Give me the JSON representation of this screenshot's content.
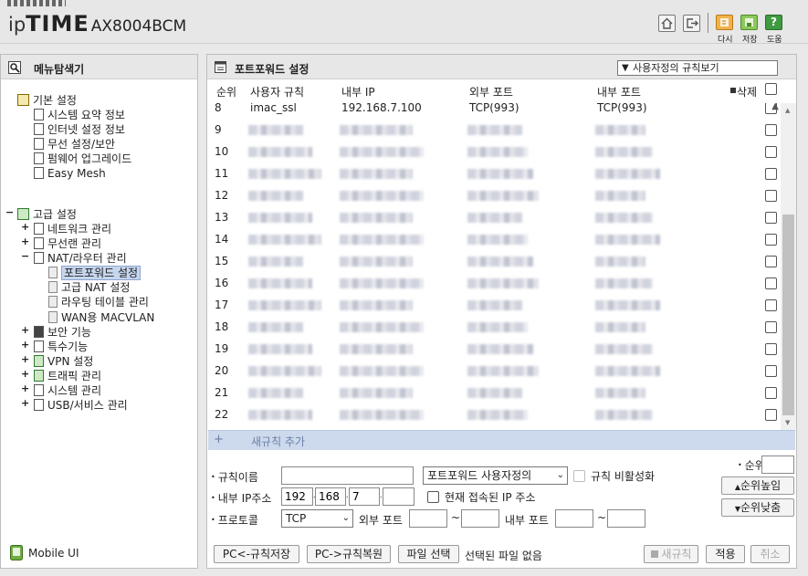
{
  "header": {
    "brand_ip": "ip",
    "brand_time": "TIME",
    "brand_model": "AX8004BCM",
    "actions": [
      {
        "label": "다시",
        "icon": "restart-icon"
      },
      {
        "label": "저장",
        "icon": "save-icon"
      },
      {
        "label": "도움",
        "icon": "help-icon"
      }
    ],
    "colors": {
      "accent_orange": "#e8a63a",
      "accent_green": "#6cae3f"
    }
  },
  "sidebar": {
    "title": "메뉴탐색기",
    "basic": {
      "label": "기본 설정",
      "items": [
        "시스템 요약 정보",
        "인터넷 설정 정보",
        "무선 설정/보안",
        "펌웨어 업그레이드",
        "Easy Mesh"
      ]
    },
    "advanced": {
      "label": "고급 설정",
      "items": [
        "네트워크 관리",
        "무선랜 관리",
        "NAT/라우터 관리"
      ],
      "nat_children": [
        "포트포워드 설정",
        "고급 NAT 설정",
        "라우팅 테이블 관리",
        "WAN용 MACVLAN"
      ],
      "rest": [
        "보안 기능",
        "특수기능",
        "VPN 설정",
        "트래픽 관리",
        "시스템 관리",
        "USB/서비스 관리"
      ]
    },
    "mobile_ui": "Mobile UI"
  },
  "main": {
    "title": "포트포워드 설정",
    "view_select": "사용자정의 규칙보기",
    "columns": {
      "num": "순위",
      "name": "사용자 규칙",
      "ip": "내부 IP",
      "ext_port": "외부 포트",
      "int_port": "내부 포트",
      "delete": "삭제"
    },
    "partial_row": {
      "num": "8",
      "name": "imac_ssl",
      "ip": "192.168.7.100",
      "ext": "TCP(993)",
      "int": "TCP(993)"
    },
    "row_numbers": [
      "9",
      "10",
      "11",
      "12",
      "13",
      "14",
      "15",
      "16",
      "17",
      "18",
      "19",
      "20",
      "21",
      "22"
    ],
    "add_rule": "새규칙 추가",
    "form": {
      "rule_name_label": "규칙이름",
      "rule_type_value": "포트포워드 사용자정의",
      "disable_label": "규칙 비활성화",
      "ip_label": "내부 IP주소",
      "ip_octets": [
        "192",
        "168",
        "7",
        ""
      ],
      "current_ip_label": "현재 접속된 IP 주소",
      "protocol_label": "프로토콜",
      "protocol_value": "TCP",
      "ext_port_label": "외부 포트",
      "int_port_label": "내부 포트",
      "tilde": "~",
      "rank_label": "순위",
      "rank_up": "순위높임",
      "rank_down": "순위낮춤"
    },
    "footer": {
      "pc_save": "PC<-규칙저장",
      "pc_restore": "PC->규칙복원",
      "file_select": "파일 선택",
      "file_status": "선택된 파일 없음",
      "new_rule": "새규칙",
      "apply": "적용",
      "cancel": "취소"
    }
  }
}
